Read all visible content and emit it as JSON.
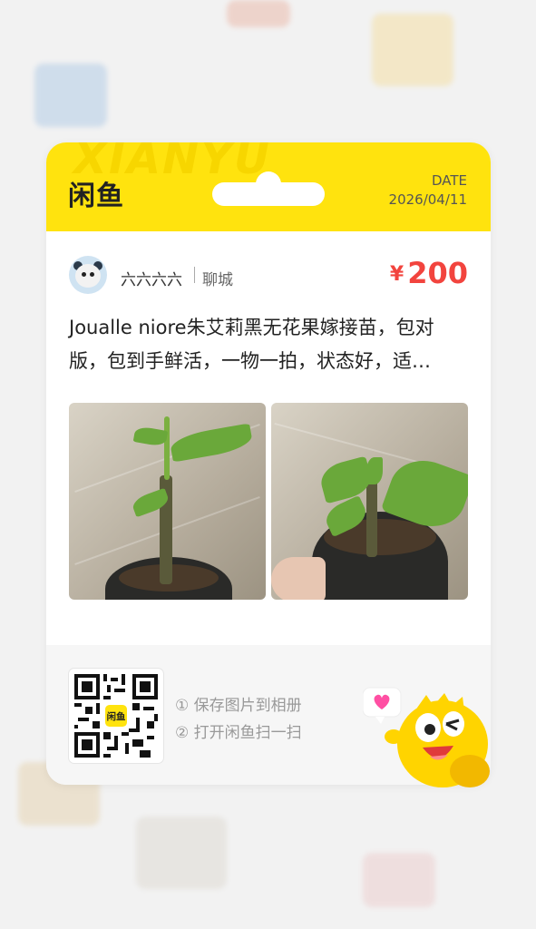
{
  "header": {
    "logo": "闲鱼",
    "watermark": "XIANYU",
    "date_label": "DATE",
    "date_value": "2026/04/11"
  },
  "seller": {
    "name": "六六六六",
    "city": "聊城",
    "avatar": "seal-avatar-icon"
  },
  "listing": {
    "currency": "¥",
    "price": "200",
    "description": "Joualle niore朱艾莉黑无花果嫁接苗，包对版，包到手鲜活，一物一拍，状态好，适…",
    "photos": [
      "fig-seedling-photo-1",
      "fig-seedling-photo-2"
    ]
  },
  "footer": {
    "step1": "① 保存图片到相册",
    "step2": "② 打开闲鱼扫一扫",
    "qr_center_label": "闲鱼"
  },
  "colors": {
    "brand_yellow": "#ffe30e",
    "price_red": "#f2443e",
    "mascot_yellow": "#ffd400",
    "heart_pink": "#ff4fa3"
  }
}
